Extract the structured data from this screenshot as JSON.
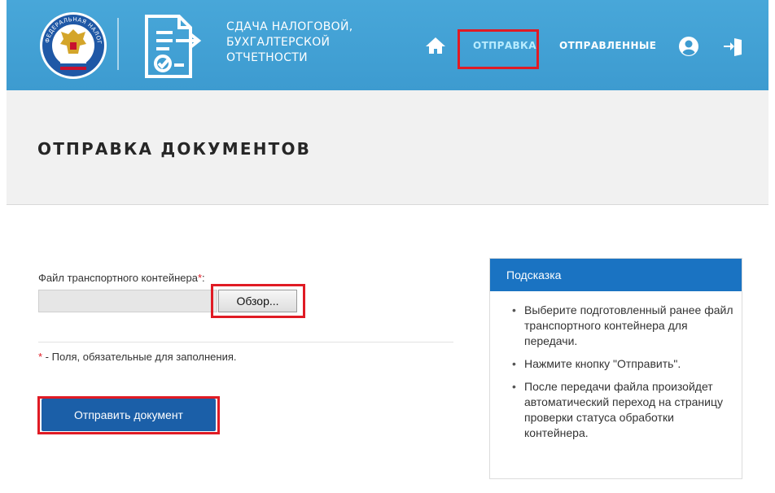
{
  "header": {
    "title_lines": [
      "СДАЧА НАЛОГОВОЙ,",
      "БУХГАЛТЕРСКОЙ",
      "ОТЧЕТНОСТИ"
    ],
    "nav": {
      "send": "ОТПРАВКА",
      "sent": "ОТПРАВЛЕННЫЕ"
    },
    "icons": {
      "home": "home-icon",
      "user": "user-icon",
      "exit": "exit-icon",
      "logo": "fns-emblem-logo",
      "doc": "document-check-icon"
    },
    "accent_color": "#3d9bd0",
    "emblem_text": "ФЕДЕРАЛЬНАЯ НАЛОГОВАЯ СЛУЖБА"
  },
  "page_title": "ОТПРАВКА ДОКУМЕНТОВ",
  "form": {
    "file_label": "Файл транспортного контейнера",
    "file_label_suffix": ":",
    "required_mark": "*",
    "file_value": "",
    "browse_label": "Обзор...",
    "required_note": " - Поля, обязательные для заполнения.",
    "submit_label": "Отправить документ"
  },
  "hint": {
    "title": "Подсказка",
    "items": [
      "Выберите подготовленный ранее файл транспортного контейнера для передачи.",
      "Нажмите кнопку \"Отправить\".",
      "После передачи файла произойдет автоматический переход на страницу проверки статуса обработки контейнера."
    ]
  },
  "highlight_color": "#e01b24"
}
